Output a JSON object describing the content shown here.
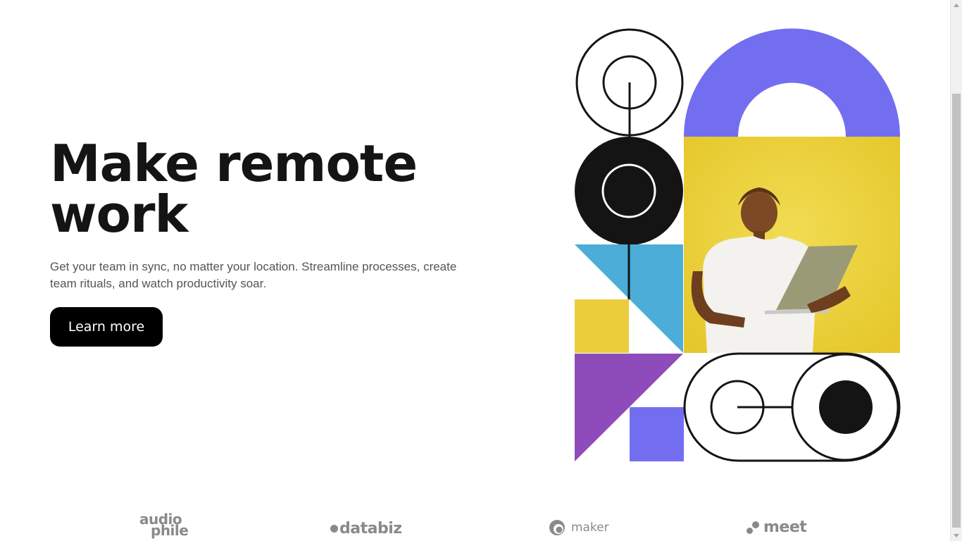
{
  "hero": {
    "title_line1": "Make remote",
    "title_line2": "work",
    "description": "Get your team in sync, no matter your location. Streamline processes, create team rituals, and watch productivity soar.",
    "cta_label": "Learn more"
  },
  "illustration": {
    "colors": {
      "purple": "#736EEF",
      "yellow": "#EBCD3C",
      "blue": "#4BADD8",
      "violet": "#8D4CBA",
      "black": "#141414"
    },
    "photo_subject": "person-with-laptop-image"
  },
  "clients": {
    "logos": [
      {
        "name_line1": "audio",
        "name_line2": "phile"
      },
      {
        "name": "databiz"
      },
      {
        "name": "maker"
      },
      {
        "name": "meet"
      }
    ]
  }
}
